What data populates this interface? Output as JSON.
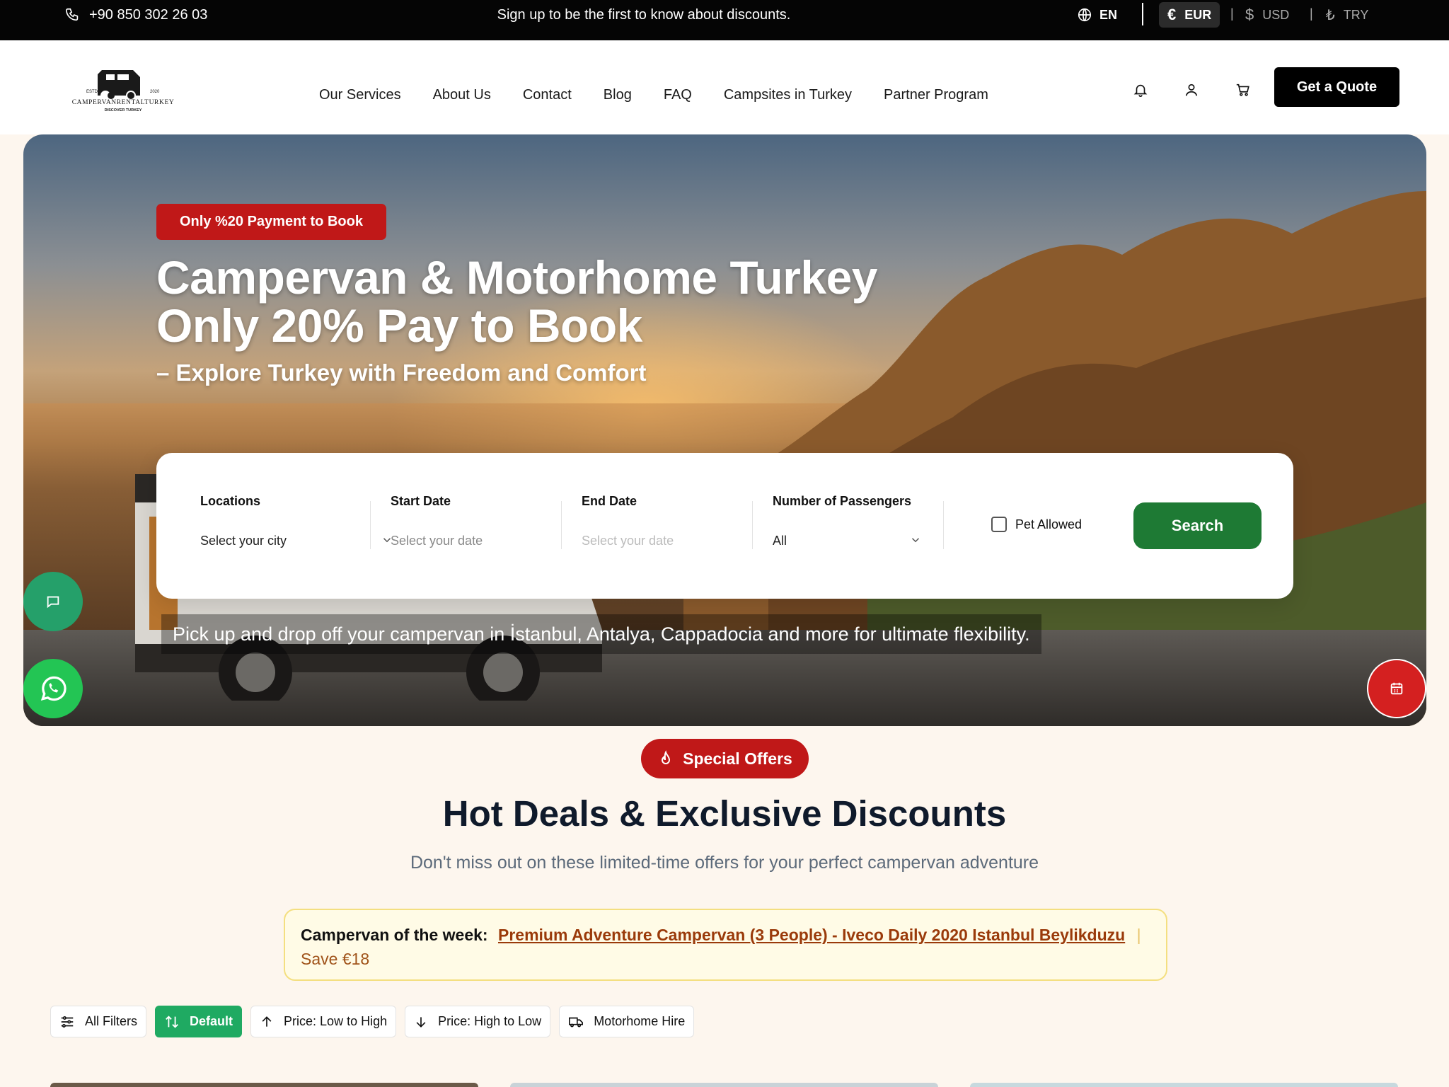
{
  "topbar": {
    "phone": "+90 850 302 26 03",
    "promo": "Sign up to be the first to know about discounts.",
    "language": "EN",
    "currencies": [
      {
        "symbol": "€",
        "code": "EUR",
        "active": true
      },
      {
        "symbol": "$",
        "code": "USD",
        "active": false
      },
      {
        "symbol": "₺",
        "code": "TRY",
        "active": false
      }
    ],
    "separator": "|"
  },
  "header": {
    "logo": {
      "est": "ESTD",
      "year": "2020",
      "brand": "CAMPERVANRENTALTURKEY",
      "tagline": "DISCOVER TURKEY"
    },
    "nav": [
      "Our Services",
      "About Us",
      "Contact",
      "Blog",
      "FAQ",
      "Campsites in Turkey",
      "Partner Program"
    ],
    "icons": [
      "bell-icon",
      "user-icon",
      "cart-icon"
    ],
    "quote_button": "Get a Quote"
  },
  "hero": {
    "badge": "Only %20 Payment to Book",
    "title_line1": "Campervan & Motorhome Turkey",
    "title_line2": "Only 20% Pay to Book",
    "subtitle": "– Explore Turkey with Freedom and Comfort",
    "caption": "Pick up and drop off your campervan in İstanbul, Antalya, Cappadocia and more for ultimate flexibility."
  },
  "search": {
    "locations": {
      "label": "Locations",
      "value": "Select your city"
    },
    "start_date": {
      "label": "Start Date",
      "placeholder": "Select your date"
    },
    "end_date": {
      "label": "End Date",
      "placeholder": "Select your date"
    },
    "passengers": {
      "label": "Number of Passengers",
      "value": "All"
    },
    "pet_allowed": "Pet Allowed",
    "button": "Search"
  },
  "offers": {
    "pill": "Special Offers",
    "title": "Hot Deals & Exclusive Discounts",
    "subtitle": "Don't miss out on these limited-time offers for your perfect campervan adventure",
    "week_lead": "Campervan of the week:",
    "week_link": "Premium Adventure Campervan (3 People) - Iveco Daily 2020 Istanbul Beylikduzu",
    "week_save": "Save €18",
    "week_bar": "|"
  },
  "filters": [
    {
      "label": "All Filters",
      "icon": "sliders-icon",
      "active": false
    },
    {
      "label": "Default",
      "icon": "sort-icon",
      "active": true
    },
    {
      "label": "Price: Low to High",
      "icon": "arrow-up-icon",
      "active": false
    },
    {
      "label": "Price: High to Low",
      "icon": "arrow-down-icon",
      "active": false
    },
    {
      "label": "Motorhome Hire",
      "icon": "van-icon",
      "active": false
    }
  ],
  "colors": {
    "brand_red": "#c01818",
    "search_green": "#1e7a34",
    "filter_green": "#1faa62",
    "whatsapp": "#23c554"
  }
}
